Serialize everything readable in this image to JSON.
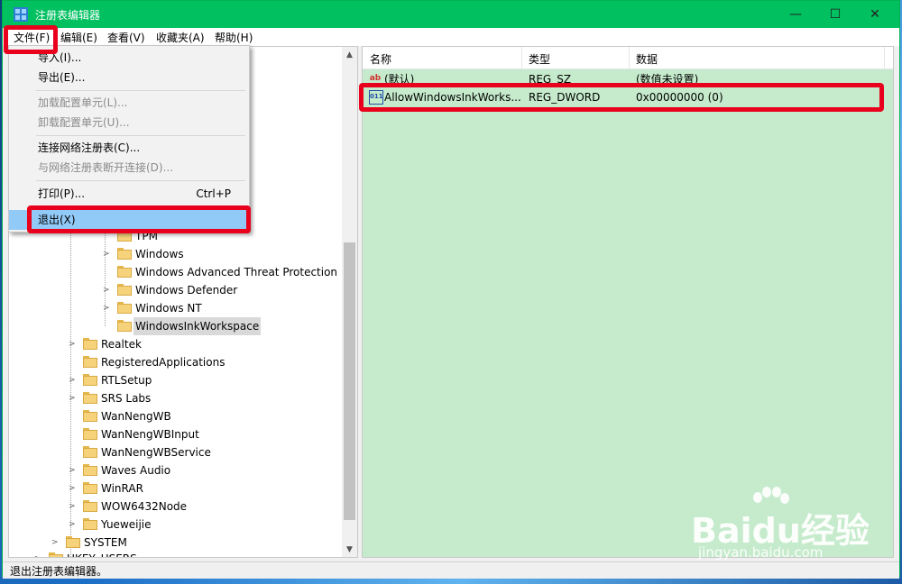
{
  "window": {
    "title": "注册表编辑器",
    "controls": {
      "minimize": "—",
      "maximize": "☐",
      "close": "✕"
    }
  },
  "menubar": {
    "items": [
      "文件(F)",
      "编辑(E)",
      "查看(V)",
      "收藏夹(A)",
      "帮助(H)"
    ]
  },
  "file_menu": {
    "items": [
      {
        "label": "导入(I)...",
        "shortcut": "",
        "disabled": false
      },
      {
        "label": "导出(E)...",
        "shortcut": "",
        "disabled": false
      },
      {
        "label": "加载配置单元(L)...",
        "shortcut": "",
        "disabled": true
      },
      {
        "label": "卸载配置单元(U)...",
        "shortcut": "",
        "disabled": true
      },
      {
        "label": "连接网络注册表(C)...",
        "shortcut": "",
        "disabled": false
      },
      {
        "label": "与网络注册表断开连接(D)...",
        "shortcut": "",
        "disabled": true
      },
      {
        "label": "打印(P)...",
        "shortcut": "Ctrl+P",
        "disabled": false
      },
      {
        "label": "退出(X)",
        "shortcut": "",
        "disabled": false,
        "highlighted": true
      }
    ]
  },
  "tree": {
    "items": [
      {
        "label": "TPM",
        "expandable": false
      },
      {
        "label": "Windows",
        "expandable": true
      },
      {
        "label": "Windows Advanced Threat Protection",
        "expandable": false
      },
      {
        "label": "Windows Defender",
        "expandable": true
      },
      {
        "label": "Windows NT",
        "expandable": true
      },
      {
        "label": "WindowsInkWorkspace",
        "expandable": false,
        "selected": true
      },
      {
        "label": "Realtek",
        "expandable": true
      },
      {
        "label": "RegisteredApplications",
        "expandable": false
      },
      {
        "label": "RTLSetup",
        "expandable": true
      },
      {
        "label": "SRS Labs",
        "expandable": true
      },
      {
        "label": "WanNengWB",
        "expandable": false
      },
      {
        "label": "WanNengWBInput",
        "expandable": false
      },
      {
        "label": "WanNengWBService",
        "expandable": false
      },
      {
        "label": "Waves Audio",
        "expandable": true
      },
      {
        "label": "WinRAR",
        "expandable": true
      },
      {
        "label": "WOW6432Node",
        "expandable": true
      },
      {
        "label": "Yueweijie",
        "expandable": true
      },
      {
        "label": "SYSTEM",
        "expandable": true
      },
      {
        "label": "HKEY_USERS",
        "expandable": true
      }
    ]
  },
  "values_list": {
    "headers": {
      "name": "名称",
      "type": "类型",
      "data": "数据"
    },
    "rows": [
      {
        "icon": "string-value-icon",
        "icon_text": "ab",
        "name": "(默认)",
        "type": "REG_SZ",
        "data": "(数值未设置)"
      },
      {
        "icon": "binary-value-icon",
        "icon_text": "011",
        "name": "AllowWindowsInkWorks...",
        "type": "REG_DWORD",
        "data": "0x00000000 (0)"
      }
    ]
  },
  "statusbar": {
    "text": "退出注册表编辑器。"
  },
  "watermark": {
    "brand": "Baidu经验",
    "url": "jingyan.baidu.com"
  },
  "colors": {
    "titlebar": "#00c060",
    "highlight_box": "#e8001c",
    "list_bg": "#c6ebcc",
    "menu_highlight": "#91c9f7"
  }
}
